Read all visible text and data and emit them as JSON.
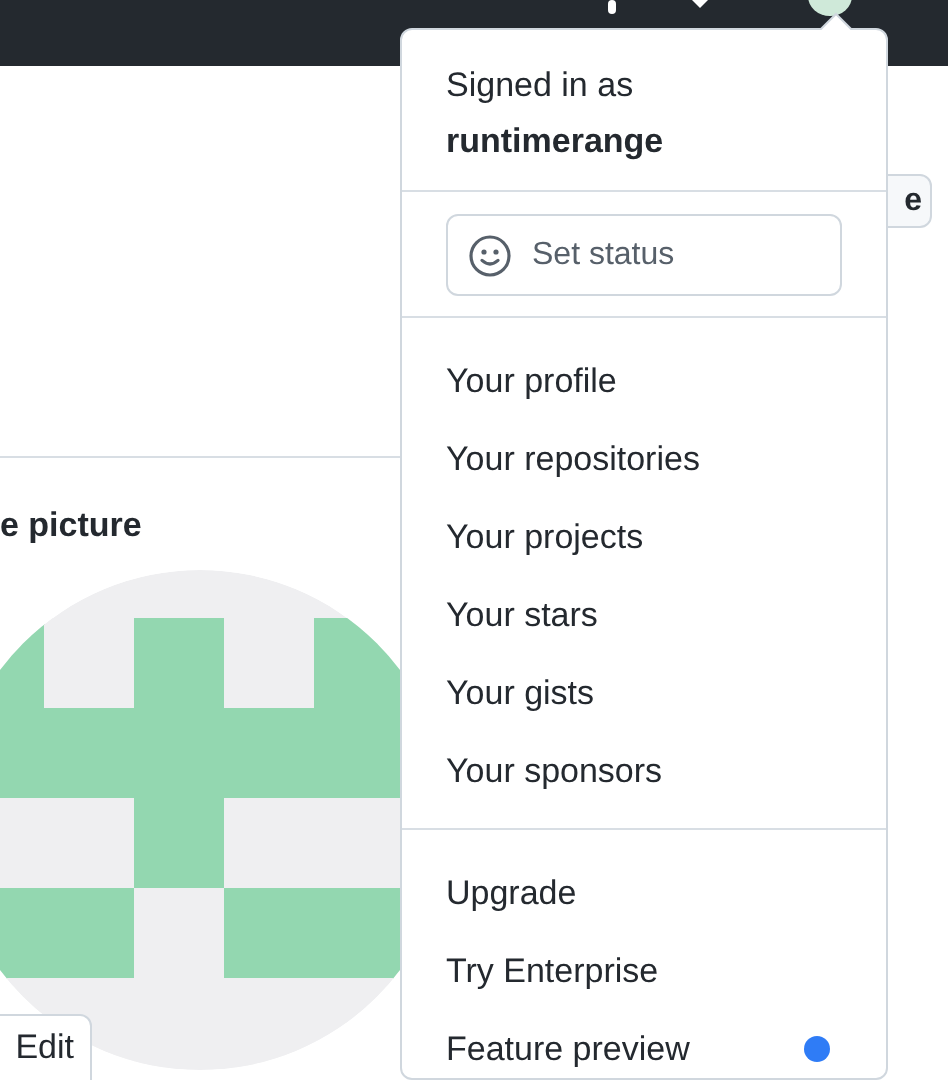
{
  "page": {
    "side_button": "e",
    "section_title": "e picture",
    "edit_button": "Edit"
  },
  "menu": {
    "signed_in_label": "Signed in as",
    "username": "runtimerange",
    "status_button": "Set status",
    "sections": [
      [
        {
          "label": "Your profile"
        },
        {
          "label": "Your repositories"
        },
        {
          "label": "Your projects"
        },
        {
          "label": "Your stars"
        },
        {
          "label": "Your gists"
        },
        {
          "label": "Your sponsors"
        }
      ],
      [
        {
          "label": "Upgrade",
          "unread": false
        },
        {
          "label": "Try Enterprise",
          "unread": false
        },
        {
          "label": "Feature preview",
          "unread": true
        }
      ]
    ]
  }
}
